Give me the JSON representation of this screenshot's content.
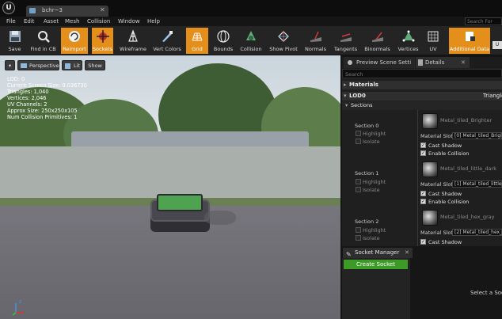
{
  "titlebar": {
    "tab_title": "bchr~3"
  },
  "menu": [
    "File",
    "Edit",
    "Asset",
    "Mesh",
    "Collision",
    "Window",
    "Help"
  ],
  "help_search_placeholder": "Search For Help",
  "toolbar": [
    {
      "label": "Save",
      "icon": "save-icon",
      "active": false
    },
    {
      "label": "Find in CB",
      "icon": "find-icon",
      "active": false
    },
    {
      "label": "Reimport",
      "icon": "reimport-icon",
      "active": true
    },
    {
      "label": "Sockets",
      "icon": "sockets-icon",
      "active": true
    },
    {
      "label": "Wireframe",
      "icon": "wireframe-icon",
      "active": false
    },
    {
      "label": "Vert Colors",
      "icon": "vert-colors-icon",
      "active": false
    },
    {
      "label": "Grid",
      "icon": "grid-icon",
      "active": true
    },
    {
      "label": "Bounds",
      "icon": "bounds-icon",
      "active": false
    },
    {
      "label": "Collision",
      "icon": "collision-icon",
      "active": false
    },
    {
      "label": "Show Pivot",
      "icon": "pivot-icon",
      "active": false
    },
    {
      "label": "Normals",
      "icon": "normals-icon",
      "active": false
    },
    {
      "label": "Tangents",
      "icon": "tangents-icon",
      "active": false
    },
    {
      "label": "Binormals",
      "icon": "binormals-icon",
      "active": false
    },
    {
      "label": "Vertices",
      "icon": "vertices-icon",
      "active": false
    },
    {
      "label": "UV",
      "icon": "uv-icon",
      "active": false
    },
    {
      "label": "Additional Data",
      "icon": "additional-data-icon",
      "active": true
    }
  ],
  "more_button": "U",
  "viewport": {
    "perspective": "Perspective",
    "lit": "Lit",
    "show": "Show",
    "info": [
      "LOD:  0",
      "Current Screen Size:  0.036730",
      "Triangles:  1,040",
      "Vertices:  2,046",
      "UV Channels:  2",
      "Approx Size: 250x250x105",
      "Num Collision Primitives:  1"
    ],
    "axis_label": "z"
  },
  "panel": {
    "tab_preview": "Preview Scene Setti",
    "tab_details": "Details",
    "search_placeholder": "Search",
    "materials_header": "Materials",
    "lod_header": "LOD0",
    "triangles_label": "Triangle",
    "sections_header": "Sections",
    "highlight_label": "Highlight",
    "isolate_label": "Isolate",
    "material_slot_label": "Material Slot",
    "cast_shadow_label": "Cast Shadow",
    "enable_collision_label": "Enable Collision",
    "sections": [
      {
        "name": "Section 0",
        "material": "Metal_tiled_Brighter",
        "slot": "[0] Metal_tiled_Bright"
      },
      {
        "name": "Section 1",
        "material": "Metal_tiled_little_dark",
        "slot": "[1] Metal_tiled_little_"
      },
      {
        "name": "Section 2",
        "material": "Metal_tiled_hex_gray",
        "slot": "[2] Metal_tiled_hex_g"
      }
    ]
  },
  "socket_manager": {
    "tab": "Socket Manager",
    "create": "Create Socket",
    "hint": "Select a Sock"
  }
}
